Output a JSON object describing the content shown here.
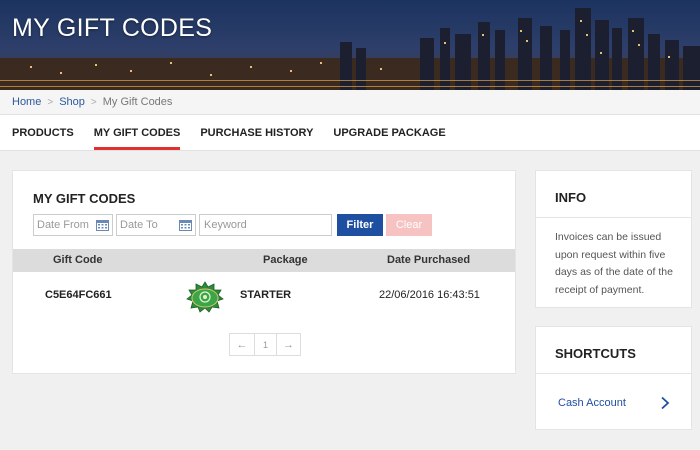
{
  "header": {
    "title": "MY GIFT CODES"
  },
  "breadcrumb": {
    "items": [
      "Home",
      "Shop"
    ],
    "separator": ">",
    "current": "My Gift Codes"
  },
  "tabs": [
    {
      "label": "PRODUCTS",
      "active": false
    },
    {
      "label": "MY GIFT CODES",
      "active": true
    },
    {
      "label": "PURCHASE HISTORY",
      "active": false
    },
    {
      "label": "UPGRADE PACKAGE",
      "active": false
    }
  ],
  "main": {
    "title": "MY GIFT CODES",
    "filters": {
      "date_from_placeholder": "Date From",
      "date_to_placeholder": "Date To",
      "keyword_placeholder": "Keyword",
      "filter_label": "Filter",
      "clear_label": "Clear"
    },
    "table": {
      "columns": [
        "Gift Code",
        "Package",
        "Date Purchased"
      ],
      "rows": [
        {
          "gift_code": "C5E64FC661",
          "package": "STARTER",
          "date": "22/06/2016 16:43:51"
        }
      ]
    },
    "pagination": {
      "prev": "←",
      "page": "1",
      "next": "→"
    }
  },
  "info": {
    "title": "INFO",
    "text": "Invoices can be issued upon request within five days as of the date of the receipt of payment."
  },
  "shortcuts": {
    "title": "SHORTCUTS",
    "items": [
      {
        "label": "Cash Account"
      }
    ]
  },
  "colors": {
    "accent_red": "#e03030",
    "primary_blue": "#1f4fa0",
    "clear_pink": "#f6c2c2",
    "badge_green": "#2e8b3a"
  }
}
